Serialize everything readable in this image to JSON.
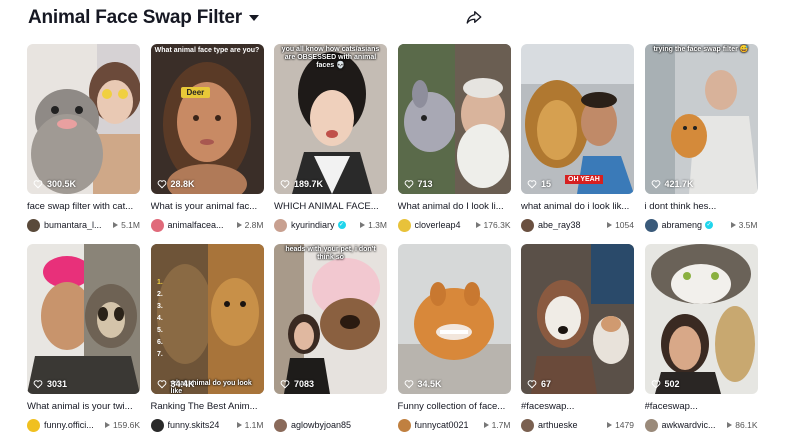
{
  "header": {
    "title": "Animal Face Swap Filter"
  },
  "icons": {
    "dropdown": "chevron-down-icon",
    "share": "share-icon",
    "likes": "heart-outline-icon",
    "plays": "play-icon"
  },
  "cards": [
    {
      "likes": "300.5K",
      "caption": "face swap filter with cat...",
      "user": "bumantara_l...",
      "plays": "5.1M",
      "verified": false,
      "avatar": "#5a4a3a",
      "overlay": ""
    },
    {
      "likes": "28.8K",
      "caption": "What is your animal fac...",
      "user": "animalfacea...",
      "plays": "2.8M",
      "verified": false,
      "avatar": "#e06a7a",
      "overlay": "What animal face type are you?",
      "sticker": "Deer"
    },
    {
      "likes": "189.7K",
      "caption": "WHICH ANIMAL FACE...",
      "user": "kyurindiary",
      "plays": "1.3M",
      "verified": true,
      "avatar": "#c8a090",
      "overlay": "you all know how cats/asians are OBSESSED with animal faces 💀"
    },
    {
      "likes": "713",
      "caption": "What animal do I look li...",
      "user": "cloverleap4",
      "plays": "176.3K",
      "verified": false,
      "avatar": "#e8c23a",
      "overlay": ""
    },
    {
      "likes": "15",
      "caption": "what animal do i look lik...",
      "user": "abe_ray38",
      "plays": "1054",
      "verified": false,
      "avatar": "#6a5040",
      "overlay": "",
      "tag": "OH YEAH"
    },
    {
      "likes": "421.7K",
      "caption": "i dont think hes...",
      "user": "abrameng",
      "plays": "3.5M",
      "verified": true,
      "avatar": "#3a5a7a",
      "overlay": "trying the face swap filter 😅"
    },
    {
      "likes": "3031",
      "caption": "What animal is your twi...",
      "user": "funny.offici...",
      "plays": "159.6K",
      "verified": false,
      "avatar": "#f0c020",
      "overlay": ""
    },
    {
      "likes": "34.4K",
      "caption": "Ranking The Best Anim...",
      "user": "funny.skits24",
      "plays": "1.1M",
      "verified": false,
      "avatar": "#2a2a2a",
      "overlay": "what animal do you look like"
    },
    {
      "likes": "7083",
      "caption": "",
      "user": "aglowbyjoan85",
      "plays": "",
      "verified": false,
      "avatar": "#8a6a5a",
      "overlay": "heads with your pet, i don't think so"
    },
    {
      "likes": "34.5K",
      "caption": "Funny collection of face...",
      "user": "funnycat0021",
      "plays": "1.7M",
      "verified": false,
      "avatar": "#c08040",
      "overlay": ""
    },
    {
      "likes": "67",
      "caption": "#faceswap...",
      "user": "arthueske",
      "plays": "1479",
      "verified": false,
      "avatar": "#7a6050",
      "overlay": ""
    },
    {
      "likes": "502",
      "caption": "#faceswap...",
      "user": "awkwardvic...",
      "plays": "86.1K",
      "verified": false,
      "avatar": "#9a8a7a",
      "overlay": ""
    }
  ]
}
